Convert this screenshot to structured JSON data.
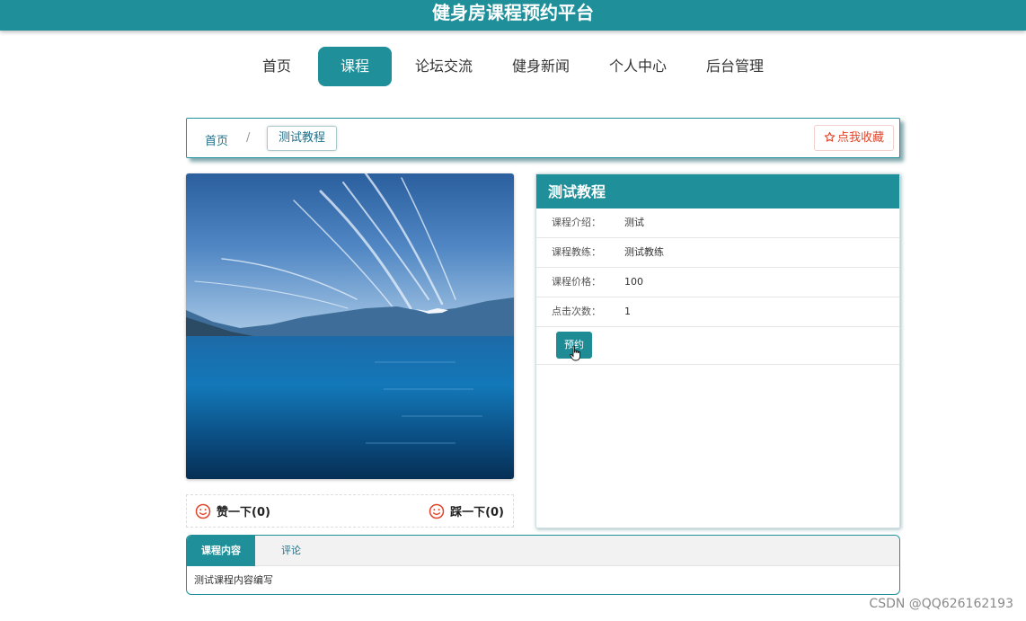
{
  "header": {
    "title": "健身房课程预约平台"
  },
  "nav": {
    "items": [
      {
        "label": "首页"
      },
      {
        "label": "课程"
      },
      {
        "label": "论坛交流"
      },
      {
        "label": "健身新闻"
      },
      {
        "label": "个人中心"
      },
      {
        "label": "后台管理"
      }
    ],
    "active_index": 1
  },
  "breadcrumb": {
    "home": "首页",
    "separator": "/",
    "current": "测试教程",
    "favorite_label": "点我收藏",
    "favorite_icon": "star-outline-icon"
  },
  "course": {
    "image": "mountain-lake-photo",
    "title": "测试教程",
    "fields": [
      {
        "key": "课程介绍：",
        "value": "测试"
      },
      {
        "key": "课程教练：",
        "value": "测试教练"
      },
      {
        "key": "课程价格：",
        "value": "100"
      },
      {
        "key": "点击次数：",
        "value": "1"
      }
    ],
    "book_label": "预约"
  },
  "votes": {
    "like_label": "赞一下(0)",
    "dislike_label": "踩一下(0)",
    "icon": "smiley-icon"
  },
  "tabs": {
    "items": [
      {
        "label": "课程内容"
      },
      {
        "label": "评论"
      }
    ],
    "active_index": 0,
    "content": "测试课程内容编写"
  },
  "watermark": "CSDN @QQ626162193",
  "colors": {
    "primary": "#1f9099",
    "accent": "#e0452b"
  }
}
